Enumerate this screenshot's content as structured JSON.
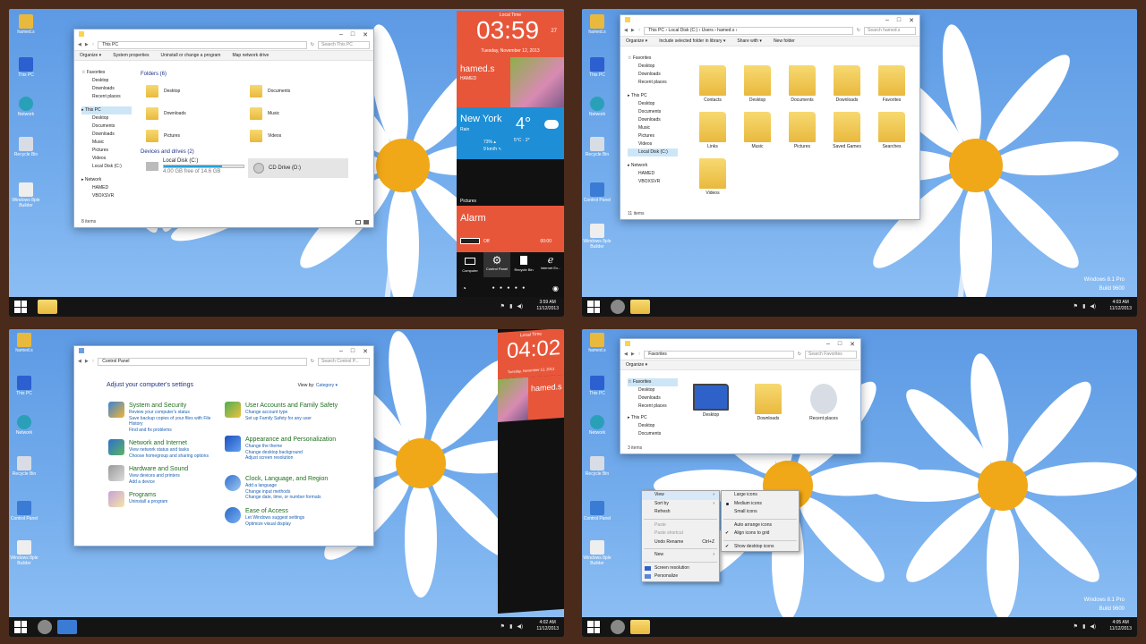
{
  "desktop_icons": [
    "hamed.s",
    "This PC",
    "Network",
    "Recycle Bin",
    "Control Panel",
    "Windows 8ple Builder"
  ],
  "q1": {
    "explorer": {
      "address": "This PC",
      "search_placeholder": "Search This PC",
      "commands": [
        "Organize ▾",
        "System properties",
        "Uninstall or change a program",
        "Map network drive"
      ],
      "nav": [
        "Favorites",
        "Desktop",
        "Downloads",
        "Recent places",
        "This PC",
        "Desktop",
        "Documents",
        "Downloads",
        "Music",
        "Pictures",
        "Videos",
        "Local Disk (C:)",
        "Network",
        "HAMED",
        "VBOXSVR"
      ],
      "folders_header": "Folders (6)",
      "folders": [
        "Desktop",
        "Documents",
        "Downloads",
        "Music",
        "Pictures",
        "Videos"
      ],
      "drives_header": "Devices and drives (2)",
      "local_disk": "Local Disk (C:)",
      "local_disk_free": "4.00 GB free of 14.6 GB",
      "local_disk_used_fraction": 0.73,
      "cd_drive": "CD Drive (D:)",
      "status": "8 items"
    },
    "sidebar": {
      "label": "Local Time",
      "clock": "03:59",
      "clock_seconds": "27",
      "date": "Tuesday, November 12, 2013",
      "user": "hamed.s",
      "host": "HAMED",
      "city": "New York",
      "weather_desc": "Rain",
      "temp": "4°",
      "temp_range": "5°C · 2°",
      "humidity": "73% ▴",
      "wind": "9 km/h ↖",
      "pictures": "Pictures",
      "alarm": "Alarm",
      "alarm_state": "Off",
      "alarm_time": "00:00",
      "shortcuts": [
        "Computer",
        "Control Panel",
        "Recycle Bin",
        "Internet Ex..."
      ]
    },
    "tray": {
      "time": "3:59 AM",
      "date": "11/12/2013"
    }
  },
  "q2": {
    "explorer": {
      "address": "This PC  ›  Local Disk (C:)  ›  Users  ›  hamed.s  ›",
      "search_placeholder": "Search hamed.s",
      "commands": [
        "Organize ▾",
        "Include selected folder in library ▾",
        "Share with ▾",
        "New folder"
      ],
      "nav": [
        "Favorites",
        "Desktop",
        "Downloads",
        "Recent places",
        "This PC",
        "Desktop",
        "Documents",
        "Downloads",
        "Music",
        "Pictures",
        "Videos",
        "Local Disk (C:)",
        "Network",
        "HAMED",
        "VBOXSVR"
      ],
      "folders": [
        "Contacts",
        "Desktop",
        "Documents",
        "Downloads",
        "Favorites",
        "Links",
        "Music",
        "Pictures",
        "Saved Games",
        "Searches",
        "Videos"
      ],
      "status": "11 items"
    },
    "watermark": [
      "Windows 8.1 Pro",
      "Build 9600"
    ],
    "tray": {
      "time": "4:03 AM",
      "date": "11/12/2013"
    }
  },
  "q3": {
    "cp": {
      "address": "Control Panel",
      "search_placeholder": "Search Control P...",
      "heading": "Adjust your computer's settings",
      "view_by_label": "View by:",
      "view_by_value": "Category ▾",
      "left": [
        {
          "title": "System and Security",
          "links": [
            "Review your computer's status",
            "Save backup copies of your files with File",
            "History",
            "Find and fix problems"
          ]
        },
        {
          "title": "Network and Internet",
          "links": [
            "View network status and tasks",
            "Choose homegroup and sharing options"
          ]
        },
        {
          "title": "Hardware and Sound",
          "links": [
            "View devices and printers",
            "Add a device"
          ]
        },
        {
          "title": "Programs",
          "links": [
            "Uninstall a program"
          ]
        }
      ],
      "right": [
        {
          "title": "User Accounts and Family Safety",
          "links": [
            "Change account type",
            "Set up Family Safety for any user"
          ]
        },
        {
          "title": "Appearance and Personalization",
          "links": [
            "Change the theme",
            "Change desktop background",
            "Adjust screen resolution"
          ]
        },
        {
          "title": "Clock, Language, and Region",
          "links": [
            "Add a language",
            "Change input methods",
            "Change date, time, or number formats"
          ]
        },
        {
          "title": "Ease of Access",
          "links": [
            "Let Windows suggest settings",
            "Optimize visual display"
          ]
        }
      ]
    },
    "sidebar": {
      "label": "Local Time",
      "clock": "04:02",
      "date": "Tuesday, November 12, 2013",
      "user": "hamed.s"
    },
    "tray": {
      "time": "4:02 AM",
      "date": "11/12/2013"
    }
  },
  "q4": {
    "explorer": {
      "address": "Favorites",
      "search_placeholder": "Search Favorites",
      "commands": [
        "Organize ▾"
      ],
      "nav": [
        "Favorites",
        "Desktop",
        "Downloads",
        "Recent places",
        "This PC",
        "Desktop",
        "Documents"
      ],
      "items": [
        "Desktop",
        "Downloads",
        "Recent places"
      ],
      "status": "3 items"
    },
    "context_menu": {
      "items": [
        {
          "label": "View",
          "arrow": "›"
        },
        {
          "label": "Sort by",
          "arrow": "›"
        },
        {
          "label": "Refresh"
        },
        {
          "label": "Paste"
        },
        {
          "label": "Paste shortcut"
        },
        {
          "label": "Undo Rename",
          "shortcut": "Ctrl+Z"
        },
        {
          "label": "New",
          "arrow": "›"
        },
        {
          "label": "Screen resolution"
        },
        {
          "label": "Personalize"
        }
      ],
      "submenu": [
        "Large icons",
        "Medium icons",
        "Small icons",
        "Auto arrange icons",
        "Align icons to grid",
        "Show desktop icons"
      ]
    },
    "watermark": [
      "Windows 8.1 Pro",
      "Build 9600"
    ],
    "tray": {
      "time": "4:05 AM",
      "date": "11/12/2013"
    }
  }
}
